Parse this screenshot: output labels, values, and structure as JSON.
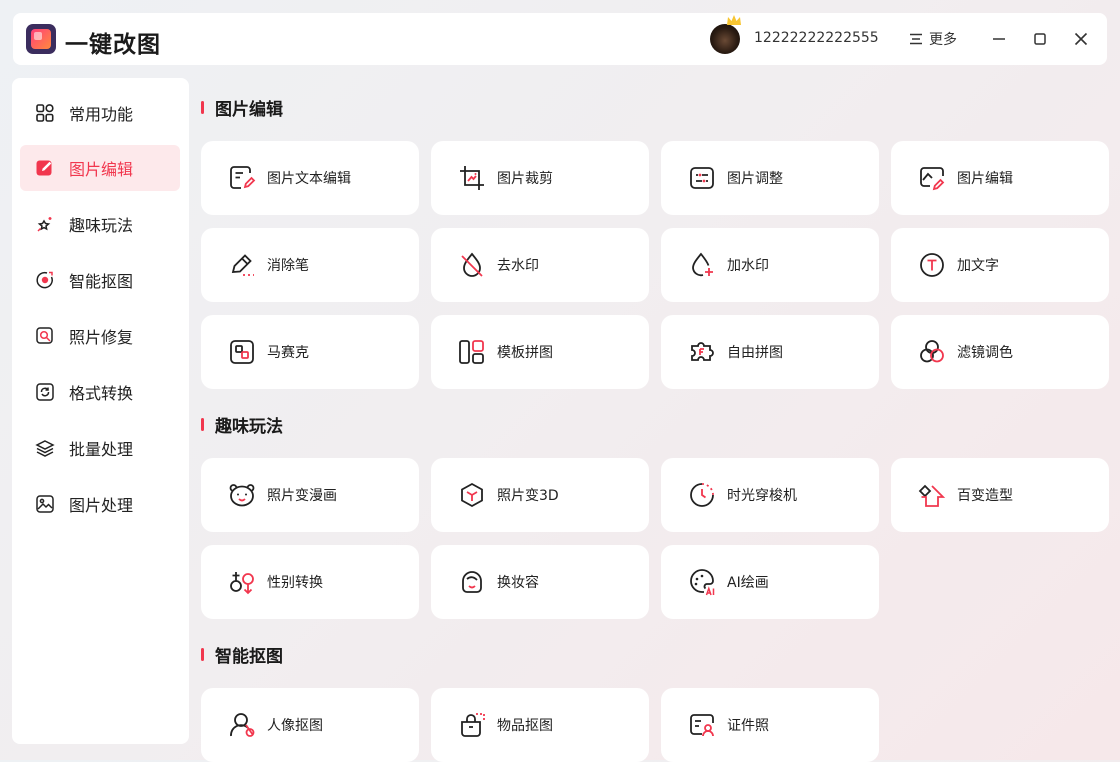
{
  "app": {
    "title": "一键改图",
    "user_id": "12222222222555",
    "more_label": "更多"
  },
  "colors": {
    "accent": "#f1374e",
    "accent_bg": "#fde9eb"
  },
  "sidebar": {
    "items": [
      {
        "label": "常用功能",
        "icon": "grid-icon"
      },
      {
        "label": "图片编辑",
        "icon": "edit-icon",
        "active": true
      },
      {
        "label": "趣味玩法",
        "icon": "magic-wand-icon"
      },
      {
        "label": "智能抠图",
        "icon": "target-icon"
      },
      {
        "label": "照片修复",
        "icon": "repair-search-icon"
      },
      {
        "label": "格式转换",
        "icon": "convert-icon"
      },
      {
        "label": "批量处理",
        "icon": "layers-icon"
      },
      {
        "label": "图片处理",
        "icon": "image-icon"
      }
    ]
  },
  "sections": [
    {
      "title": "图片编辑",
      "items": [
        {
          "label": "图片文本编辑",
          "icon": "image-text-edit-icon"
        },
        {
          "label": "图片裁剪",
          "icon": "crop-icon"
        },
        {
          "label": "图片调整",
          "icon": "adjust-icon"
        },
        {
          "label": "图片编辑",
          "icon": "image-edit-icon"
        },
        {
          "label": "消除笔",
          "icon": "eraser-pen-icon"
        },
        {
          "label": "去水印",
          "icon": "remove-watermark-icon"
        },
        {
          "label": "加水印",
          "icon": "add-watermark-icon"
        },
        {
          "label": "加文字",
          "icon": "add-text-icon"
        },
        {
          "label": "马赛克",
          "icon": "mosaic-icon"
        },
        {
          "label": "模板拼图",
          "icon": "template-collage-icon"
        },
        {
          "label": "自由拼图",
          "icon": "puzzle-icon"
        },
        {
          "label": "滤镜调色",
          "icon": "filter-icon"
        }
      ]
    },
    {
      "title": "趣味玩法",
      "items": [
        {
          "label": "照片变漫画",
          "icon": "bear-face-icon"
        },
        {
          "label": "照片变3D",
          "icon": "cube-icon"
        },
        {
          "label": "时光穿梭机",
          "icon": "clock-icon"
        },
        {
          "label": "百变造型",
          "icon": "shape-icon"
        },
        {
          "label": "性别转换",
          "icon": "gender-icon"
        },
        {
          "label": "换妆容",
          "icon": "makeup-face-icon"
        },
        {
          "label": "AI绘画",
          "icon": "palette-ai-icon"
        }
      ]
    },
    {
      "title": "智能抠图",
      "items": [
        {
          "label": "人像抠图",
          "icon": "portrait-cutout-icon"
        },
        {
          "label": "物品抠图",
          "icon": "bag-cutout-icon"
        },
        {
          "label": "证件照",
          "icon": "id-photo-icon"
        }
      ]
    }
  ]
}
